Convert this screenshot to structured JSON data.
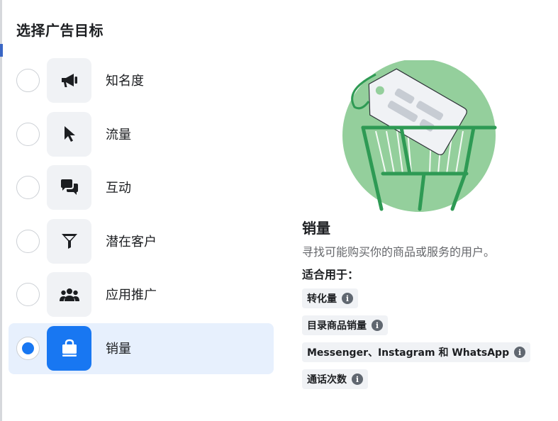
{
  "title": "选择广告目标",
  "options": [
    {
      "label": "知名度",
      "icon": "megaphone-icon",
      "selected": false
    },
    {
      "label": "流量",
      "icon": "cursor-icon",
      "selected": false
    },
    {
      "label": "互动",
      "icon": "chat-bubbles-icon",
      "selected": false
    },
    {
      "label": "潜在客户",
      "icon": "funnel-icon",
      "selected": false
    },
    {
      "label": "应用推广",
      "icon": "people-icon",
      "selected": false
    },
    {
      "label": "销量",
      "icon": "shopping-bag-icon",
      "selected": true
    }
  ],
  "detail": {
    "title": "销量",
    "description": "寻找可能购买你的商品或服务的用户。",
    "suitable_label": "适合用于：",
    "chips": [
      {
        "label": "转化量"
      },
      {
        "label": "目录商品销量"
      },
      {
        "label": "Messenger、Instagram 和 WhatsApp"
      },
      {
        "label": "通话次数"
      }
    ],
    "info_glyph": "i"
  },
  "colors": {
    "accent": "#1877f2",
    "selected_bg": "#e7f0fd",
    "illustration_green": "#94cf9c",
    "illustration_dark_green": "#2e9a54"
  }
}
